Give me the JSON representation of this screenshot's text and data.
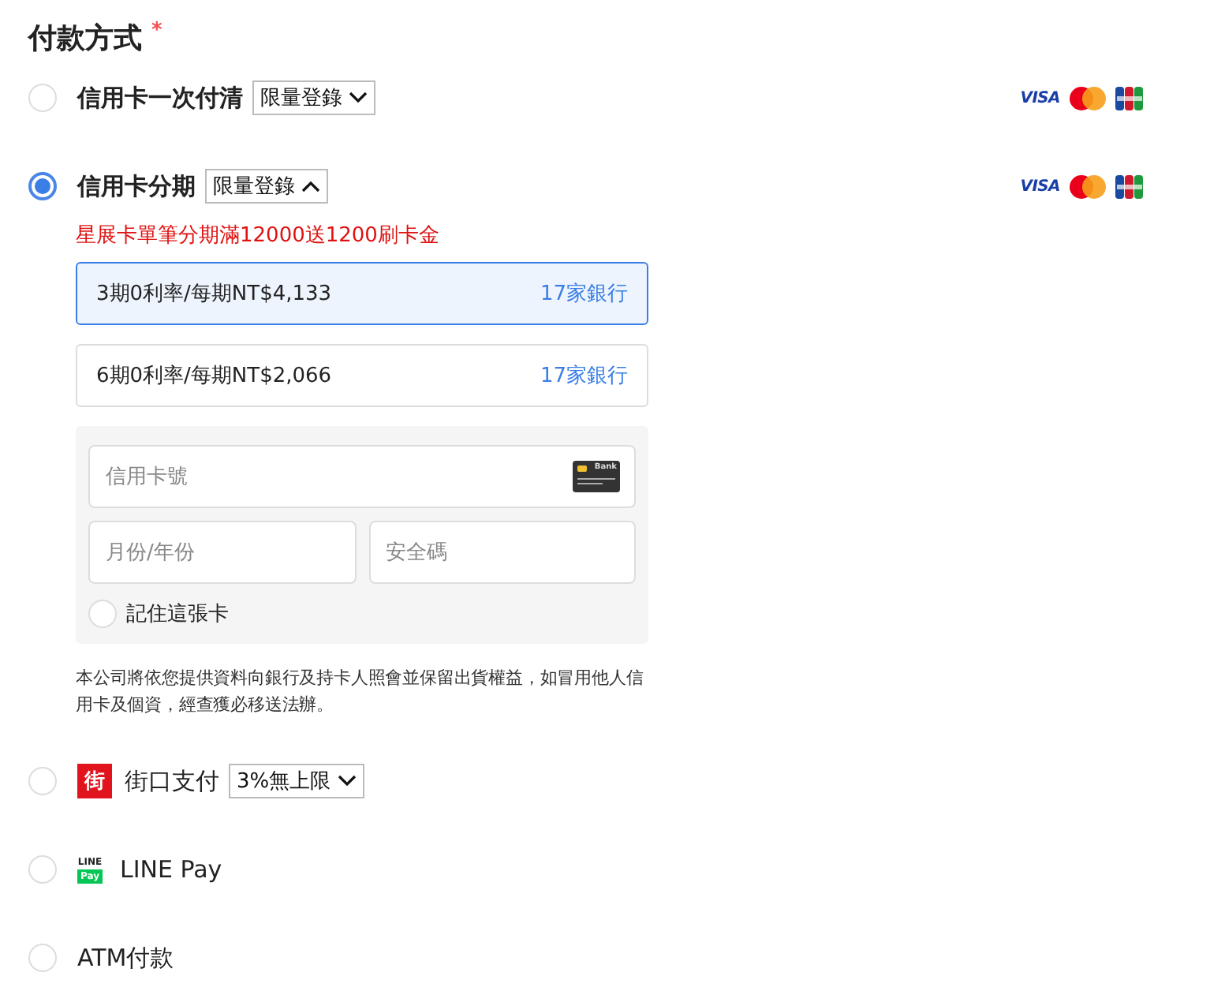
{
  "title": "付款方式",
  "required_mark": "*",
  "methods": [
    {
      "kind": "card",
      "label": "信用卡一次付清",
      "selected": false,
      "tag": {
        "label": "限量登錄",
        "expanded": false
      },
      "brands": [
        {
          "kind": "visa",
          "text": "VISA"
        },
        {
          "kind": "mastercard"
        },
        {
          "kind": "jcb"
        }
      ]
    },
    {
      "kind": "card",
      "label": "信用卡分期",
      "selected": true,
      "tag": {
        "label": "限量登錄",
        "expanded": true
      },
      "brands": [
        {
          "kind": "visa",
          "text": "VISA"
        },
        {
          "kind": "mastercard"
        },
        {
          "kind": "jcb"
        }
      ],
      "details": {
        "promo": "星展卡單筆分期滿12000送1200刷卡金",
        "plans": [
          {
            "label": "3期0利率/每期NT$4,133",
            "banks": "17家銀行",
            "selected": true
          },
          {
            "label": "6期0利率/每期NT$2,066",
            "banks": "17家銀行",
            "selected": false
          }
        ],
        "form": {
          "card_number": {
            "placeholder": "信用卡號",
            "card_icon_text": "Bank"
          },
          "expiry": {
            "placeholder": "月份/年份"
          },
          "cvc": {
            "placeholder": "安全碼"
          },
          "remember": {
            "label": "記住這張卡",
            "checked": false
          }
        },
        "notice": "本公司將依您提供資料向銀行及持卡人照會並保留出貨權益，如冒用他人信用卡及個資，經查獲必移送法辦。"
      }
    },
    {
      "kind": "jko",
      "label": "街口支付",
      "selected": false,
      "logo": {
        "text": "街"
      },
      "tag": {
        "label": "3%無上限",
        "expanded": false
      }
    },
    {
      "kind": "linepay",
      "label": "LINE Pay",
      "selected": false,
      "logo": {
        "top": "LINE",
        "bottom": "Pay"
      }
    },
    {
      "kind": "plain",
      "label": "ATM付款",
      "selected": false
    }
  ]
}
